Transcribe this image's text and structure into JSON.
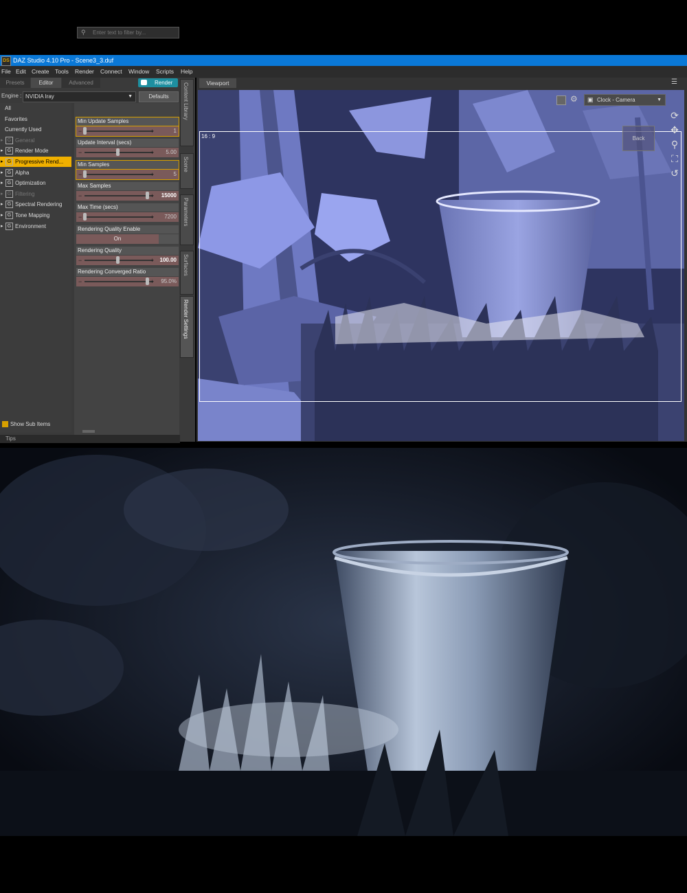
{
  "window": {
    "title": "DAZ Studio 4.10 Pro - Scene3_3.duf",
    "app_icon_text": "DS",
    "accent_color": "#0a78d7"
  },
  "menu": [
    "File",
    "Edit",
    "Create",
    "Tools",
    "Render",
    "Connect",
    "Window",
    "Scripts",
    "Help"
  ],
  "render_panel": {
    "tabs": [
      "Presets",
      "Editor",
      "Advanced"
    ],
    "active_tab": "Editor",
    "render_button": "Render",
    "engine_label": "Engine :",
    "engine_value": "NVIDIA Iray",
    "defaults_button": "Defaults",
    "filter_placeholder": "Enter text to filter by...",
    "nav": [
      {
        "label": "All",
        "icon": false,
        "dim": false,
        "selected": false
      },
      {
        "label": "Favorites",
        "icon": false,
        "dim": false,
        "selected": false
      },
      {
        "label": "Currently Used",
        "icon": false,
        "dim": false,
        "selected": false
      },
      {
        "label": "General",
        "icon": true,
        "dim": true,
        "selected": false
      },
      {
        "label": "Render Mode",
        "icon": true,
        "dim": false,
        "selected": false
      },
      {
        "label": "Progressive Rend...",
        "icon": true,
        "dim": false,
        "selected": true
      },
      {
        "label": "Alpha",
        "icon": true,
        "dim": false,
        "selected": false
      },
      {
        "label": "Optimization",
        "icon": true,
        "dim": false,
        "selected": false
      },
      {
        "label": "Filtering",
        "icon": true,
        "dim": true,
        "selected": false
      },
      {
        "label": "Spectral Rendering",
        "icon": true,
        "dim": false,
        "selected": false
      },
      {
        "label": "Tone Mapping",
        "icon": true,
        "dim": false,
        "selected": false
      },
      {
        "label": "Environment",
        "icon": true,
        "dim": false,
        "selected": false
      }
    ],
    "properties": [
      {
        "label": "Min Update Samples",
        "value": "1",
        "fraction": 0.0,
        "highlight": true,
        "strong": false
      },
      {
        "label": "Update Interval (secs)",
        "value": "5.00",
        "fraction": 0.5,
        "highlight": false,
        "strong": false
      },
      {
        "label": "Min Samples",
        "value": "5",
        "fraction": 0.0,
        "highlight": true,
        "strong": false
      },
      {
        "label": "Max Samples",
        "value": "15000",
        "fraction": 0.95,
        "highlight": false,
        "strong": true
      },
      {
        "label": "Max Time (secs)",
        "value": "7200",
        "fraction": 0.0,
        "highlight": false,
        "strong": false
      },
      {
        "label": "Rendering Quality Enable",
        "value": "On",
        "toggle": true
      },
      {
        "label": "Rendering Quality",
        "value": "100.00",
        "fraction": 0.5,
        "highlight": false,
        "strong": true
      },
      {
        "label": "Rendering Converged Ratio",
        "value": "95.0%",
        "fraction": 0.95,
        "highlight": false,
        "strong": false
      }
    ],
    "show_sub_items": "Show Sub Items",
    "tips_label": "Tips"
  },
  "side_tabs": [
    "Content Library",
    "Scene",
    "Parameters",
    "Surfaces",
    "Render Settings"
  ],
  "viewport": {
    "tab": "Viewport",
    "camera": "Clock - Camera",
    "aspect_ratio": "16 : 9",
    "cube_label": "Back",
    "bg_color": "#8f9de0"
  }
}
